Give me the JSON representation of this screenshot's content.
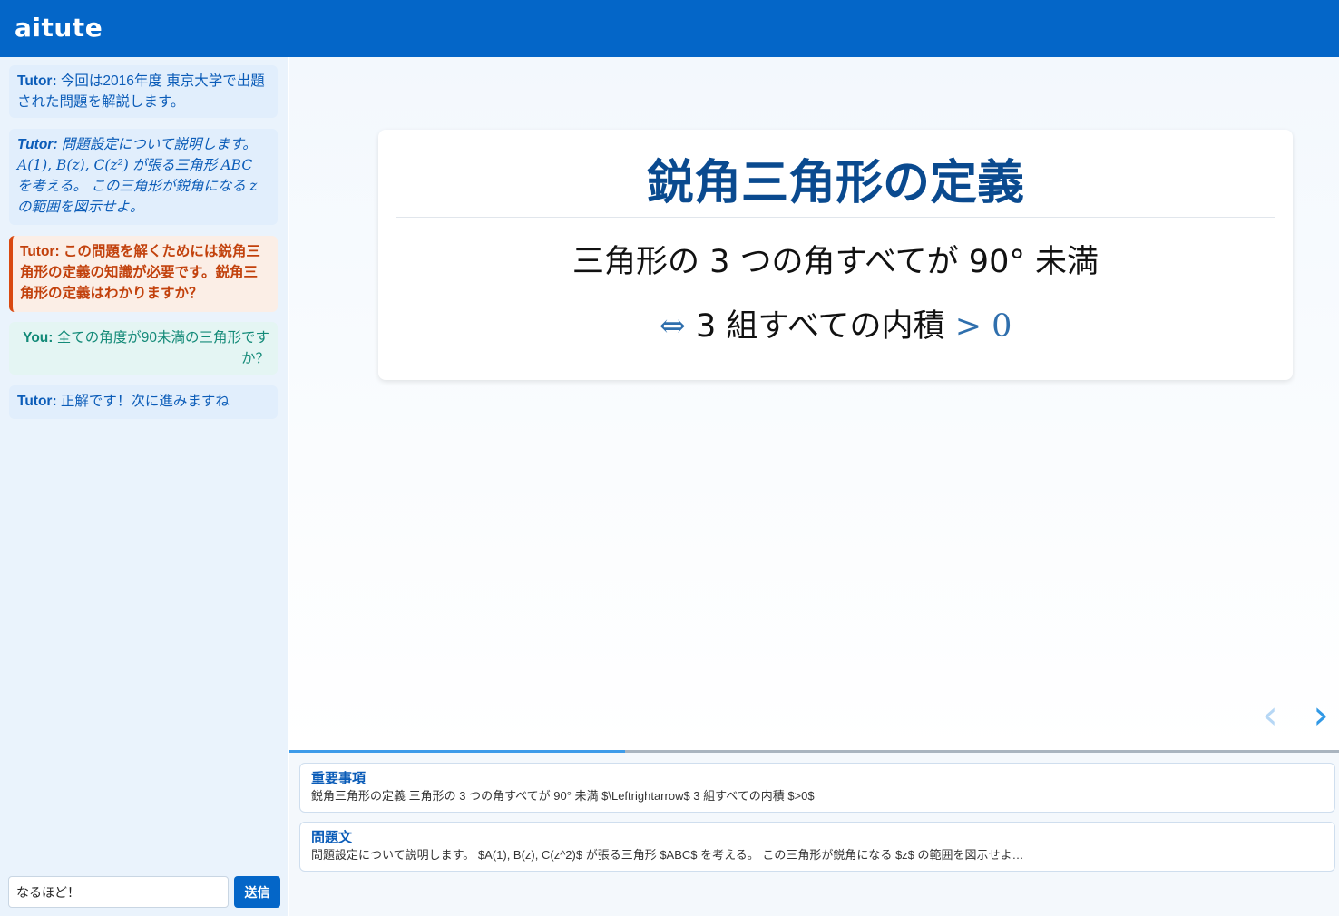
{
  "app": {
    "title": "aitute"
  },
  "chat": {
    "messages": [
      {
        "speaker": "Tutor:",
        "text": " 今回は2016年度 東京大学で出題された問題を解説します。"
      },
      {
        "speaker": "Tutor:",
        "text_a": " 問題設定について説明します。",
        "math_a": "A(1), B(z), C(z²)",
        "text_b": " が張る三角形 ",
        "math_b": "ABC",
        "text_c": " を考える。 この三角形が鋭角になる ",
        "math_c": "z",
        "text_d": " の範囲を図示せよ。"
      },
      {
        "speaker": "Tutor:",
        "text": " この問題を解くためには鋭角三角形の定義の知識が必要です。鋭角三角形の定義はわかりますか？"
      },
      {
        "speaker": "You:",
        "text": " 全ての角度が90未満の三角形ですか？"
      },
      {
        "speaker": "Tutor:",
        "text": " 正解です！次に進みますね"
      }
    ],
    "input_value": "なるほど！",
    "send_label": "送信"
  },
  "slide": {
    "title": "鋭角三角形の定義",
    "line1": "三角形の 3 つの角すべてが 90° 未満",
    "line2_symbol": "⇔",
    "line2_text": " 3 組すべての内積 ",
    "line2_rel": "> 0",
    "nav_prev": "‹",
    "nav_next": "›"
  },
  "progress": {
    "value": 0.32
  },
  "cards": [
    {
      "label": "重要事項",
      "text": "鋭角三角形の定義 三角形の 3 つの角すべてが 90° 未満 $\\Leftrightarrow$ 3 組すべての内積 $>0$"
    },
    {
      "label": "問題文",
      "text": "問題設定について説明します。 $A(1), B(z), C(z^2)$ が張る三角形 $ABC$ を考える。 この三角形が鋭角になる $z$ の範囲を図示せよ…"
    }
  ],
  "colors": {
    "brand": "#0466c8",
    "tutor_text": "#0b5cb8",
    "highlight_text": "#c2410c",
    "you_text": "#138a78",
    "progress": "#3d9be9"
  }
}
